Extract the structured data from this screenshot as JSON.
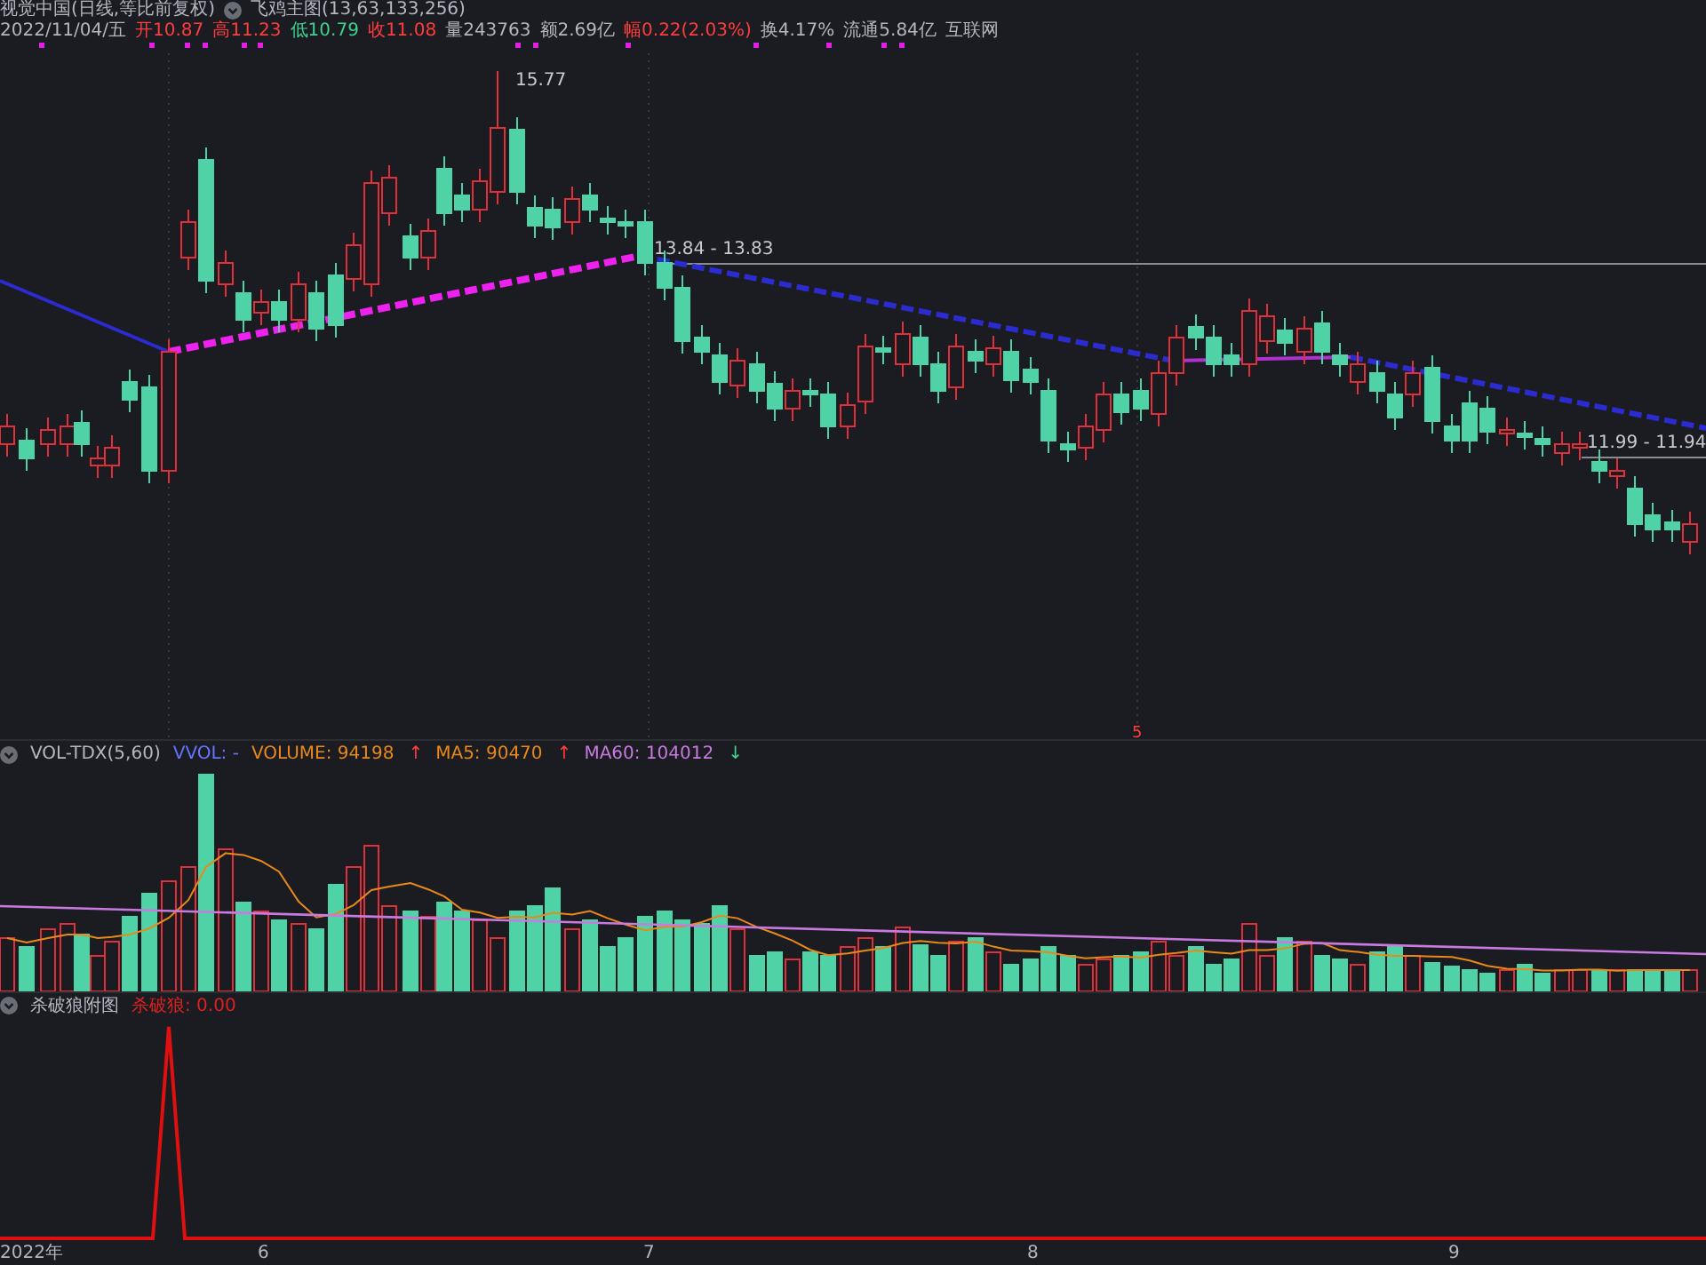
{
  "header": {
    "title": "视觉中国(日线,等比前复权)",
    "indicator": "飞鸡主图(13,63,133,256)",
    "quote": [
      {
        "text": "2022/11/04/五",
        "color": "#b4b7bf"
      },
      {
        "text": "开10.87",
        "color": "#ff3d3d"
      },
      {
        "text": "高11.23",
        "color": "#ff3d3d"
      },
      {
        "text": "低10.79",
        "color": "#3fd18f"
      },
      {
        "text": "收11.08",
        "color": "#ff3d3d"
      },
      {
        "text": "量243763",
        "color": "#b4b7bf"
      },
      {
        "text": "额2.69亿",
        "color": "#b4b7bf"
      },
      {
        "text": "幅0.22(2.03%)",
        "color": "#ff3d3d"
      },
      {
        "text": "换4.17%",
        "color": "#b4b7bf"
      },
      {
        "text": "流通5.84亿",
        "color": "#b4b7bf"
      },
      {
        "text": "互联网",
        "color": "#b4b7bf"
      }
    ]
  },
  "price_chart": {
    "high_label": "15.77",
    "range_labels": [
      "13.84 - 13.83",
      "11.99 - 11.94"
    ],
    "signal_mark": "5"
  },
  "volume_panel": {
    "legend": [
      {
        "text": "VOL-TDX(5,60)",
        "color": "#b4b7bf"
      },
      {
        "text": "VVOL: -",
        "color": "#6673ff"
      },
      {
        "text": "VOLUME: 94198",
        "color": "#e8891a",
        "arrow": {
          "text": "↑",
          "color": "#ff3d3d"
        }
      },
      {
        "text": "MA5: 90470",
        "color": "#e8891a",
        "arrow": {
          "text": "↑",
          "color": "#ff3d3d"
        }
      },
      {
        "text": "MA60: 104012",
        "color": "#c97ae0",
        "arrow": {
          "text": "↓",
          "color": "#3fd18f"
        }
      }
    ]
  },
  "indicator_panel": {
    "name": "杀破狼附图",
    "reading": "杀破狼: 0.00"
  },
  "time_axis": [
    "2022年",
    "6",
    "7",
    "8",
    "9"
  ]
}
